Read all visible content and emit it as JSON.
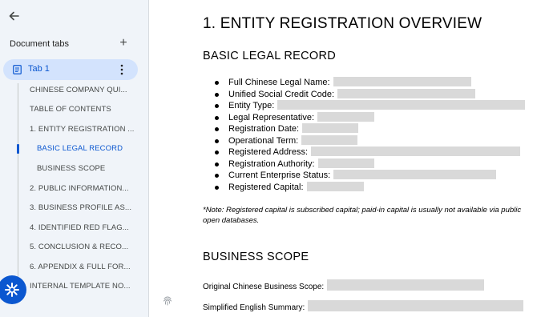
{
  "sidebar": {
    "header": "Document tabs",
    "tab": {
      "label": "Tab 1"
    },
    "outline": [
      "CHINESE COMPANY QUI...",
      "TABLE OF CONTENTS",
      "1. ENTITY REGISTRATION ...",
      "BASIC LEGAL RECORD",
      "BUSINESS SCOPE",
      "2. PUBLIC INFORMATION...",
      "3. BUSINESS PROFILE AS...",
      "4. IDENTIFIED RED FLAG...",
      "5. CONCLUSION & RECO...",
      "6. APPENDIX & FULL FOR...",
      "INTERNAL TEMPLATE NO..."
    ]
  },
  "document": {
    "title": "1. ENTITY REGISTRATION OVERVIEW",
    "section1": "BASIC LEGAL RECORD",
    "fields": [
      "Full Chinese Legal Name:",
      "Unified Social Credit Code:",
      "Entity Type:",
      "Legal Representative:",
      "Registration Date:",
      "Operational Term:",
      "Registered Address:",
      "Registration Authority:",
      "Current Enterprise Status:",
      "Registered Capital:"
    ],
    "note": "*Note: Registered capital is subscribed capital; paid-in capital is usually not available via public open databases.",
    "section2": "BUSINESS SCOPE",
    "scope_fields": [
      "Original Chinese Business Scope:",
      "Simplified English Summary:"
    ]
  },
  "icons": {
    "back": "arrow-left-icon",
    "add": "plus-icon",
    "tab": "document-icon",
    "more": "more-vert-icon",
    "fab": "gemini-sparkle-icon",
    "fingerprint": "fingerprint-icon"
  },
  "colors": {
    "sidebar_bg": "#f0f4f9",
    "accent": "#0b57d0",
    "active_tab_bg": "#d3e3fd",
    "redaction": "#d9d9d9"
  }
}
